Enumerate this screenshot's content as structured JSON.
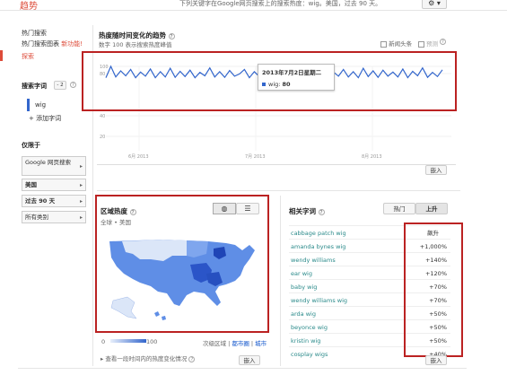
{
  "header": {
    "brand": "趋势",
    "description": "下列关键字在Google网页搜索上的搜索热度：wig。美国，过去 90 天。",
    "settings_icon": "gear-icon",
    "chevron": "▾"
  },
  "sidebar": {
    "items": [
      {
        "label": "热门搜索"
      },
      {
        "label": "热门搜索图表",
        "badge": "新功能!"
      },
      {
        "label": "探索"
      }
    ],
    "search_terms_title": "搜索字词",
    "term_tag": "- 2",
    "term": "wig",
    "add_term": "添加字词",
    "restrict_title": "仅限于",
    "filters": [
      {
        "label": "Google 网页搜索"
      },
      {
        "label": "美国"
      },
      {
        "label": "过去 90 天"
      },
      {
        "label": "所有类别"
      }
    ]
  },
  "interest": {
    "title": "热度随时间变化的趋势",
    "subtitle": "数字 100 表示搜索热度峰值",
    "news_headlines": "新闻头条",
    "forecast": "预测",
    "embed": "嵌入",
    "tooltip": {
      "date": "2013年7月2日星期二",
      "series": "wig",
      "value": "80"
    }
  },
  "chart_data": {
    "type": "line",
    "series": [
      {
        "name": "wig",
        "values": [
          70,
          100,
          72,
          88,
          75,
          92,
          70,
          85,
          74,
          93,
          70,
          86,
          72,
          95,
          71,
          87,
          73,
          90,
          70,
          84,
          75,
          96,
          72,
          86,
          71,
          89,
          74,
          80,
          92,
          70,
          86,
          73,
          93,
          71,
          87,
          75,
          90,
          70,
          84,
          72,
          94,
          71,
          88,
          73,
          91,
          70,
          85,
          74,
          92,
          72,
          86,
          70,
          95,
          73,
          88,
          71,
          90,
          74,
          85,
          72,
          93,
          70,
          87,
          75,
          96,
          71,
          84,
          73,
          91
        ]
      }
    ],
    "y_ticks": [
      "100",
      "80",
      "40",
      "20"
    ],
    "x_ticks": [
      "6月 2013",
      "7月 2013",
      "8月 2013"
    ],
    "ylim": [
      0,
      100
    ]
  },
  "region": {
    "title": "区域热度",
    "breadcrumb": "全球 • 美国",
    "legend_min": "0",
    "legend_max": "100",
    "links": [
      "次级区域",
      "都市圈",
      "城市"
    ],
    "timeline_check": "查看一段时间内的热度变化情况",
    "embed": "嵌入"
  },
  "related": {
    "title": "相关字词",
    "tab_top": "热门",
    "tab_rising": "上升",
    "header_value": "飙升",
    "rows": [
      {
        "term": "cabbage patch wig",
        "value": ""
      },
      {
        "term": "amanda bynes wig",
        "value": "+1,000%"
      },
      {
        "term": "wendy williams",
        "value": "+140%"
      },
      {
        "term": "ear wig",
        "value": "+120%"
      },
      {
        "term": "baby wig",
        "value": "+70%"
      },
      {
        "term": "wendy williams wig",
        "value": "+70%"
      },
      {
        "term": "arda wig",
        "value": "+50%"
      },
      {
        "term": "beyonce wig",
        "value": "+50%"
      },
      {
        "term": "kristin wig",
        "value": "+50%"
      },
      {
        "term": "cosplay wigs",
        "value": "+40%"
      }
    ],
    "embed": "嵌入"
  },
  "colors": {
    "accent_red": "#dd4b39",
    "line_blue": "#3366cc",
    "box_red": "#b22222"
  }
}
